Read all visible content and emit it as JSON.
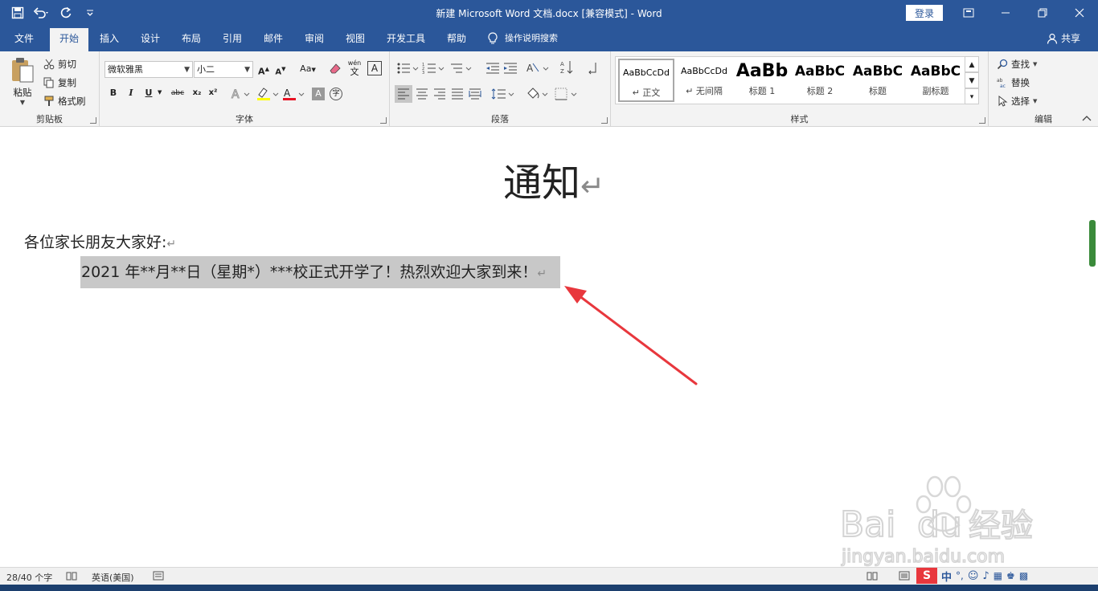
{
  "window": {
    "title": "新建 Microsoft Word 文档.docx [兼容模式] - Word",
    "login_label": "登录",
    "share_label": "共享"
  },
  "tabs": [
    {
      "label": "文件"
    },
    {
      "label": "开始"
    },
    {
      "label": "插入"
    },
    {
      "label": "设计"
    },
    {
      "label": "布局"
    },
    {
      "label": "引用"
    },
    {
      "label": "邮件"
    },
    {
      "label": "审阅"
    },
    {
      "label": "视图"
    },
    {
      "label": "开发工具"
    },
    {
      "label": "帮助"
    }
  ],
  "tell_me": "操作说明搜索",
  "ribbon": {
    "clipboard": {
      "label": "剪贴板",
      "paste": "粘贴",
      "cut": "剪切",
      "copy": "复制",
      "format_painter": "格式刷"
    },
    "font": {
      "label": "字体",
      "font_name": "微软雅黑",
      "font_size": "小二",
      "case_label": "Aa",
      "phonetic_label": "wén",
      "bold": "B",
      "italic": "I",
      "underline": "U",
      "strike": "abc",
      "subscript": "x₂",
      "superscript": "x²"
    },
    "paragraph": {
      "label": "段落"
    },
    "styles": {
      "label": "样式",
      "items": [
        {
          "preview": "AaBbCcDd",
          "name": "↵ 正文"
        },
        {
          "preview": "AaBbCcDd",
          "name": "↵ 无间隔"
        },
        {
          "preview": "AaBb",
          "name": "标题 1"
        },
        {
          "preview": "AaBbC",
          "name": "标题 2"
        },
        {
          "preview": "AaBbC",
          "name": "标题"
        },
        {
          "preview": "AaBbC",
          "name": "副标题"
        }
      ]
    },
    "editing": {
      "label": "编辑",
      "find": "查找",
      "replace": "替换",
      "select": "选择"
    }
  },
  "document": {
    "heading": "通知",
    "greeting": "各位家长朋友大家好:",
    "body_line": "2021 年**月**日（星期*）***校正式开学了！热烈欢迎大家到来！",
    "paragraph_mark": "↵"
  },
  "status": {
    "words": "28/40 个字",
    "language": "英语(美国)"
  },
  "ime": {
    "mode": "中"
  },
  "colors": {
    "accent": "#2b579a",
    "arrow": "#e8373d",
    "selection": "#c8c8c8"
  }
}
